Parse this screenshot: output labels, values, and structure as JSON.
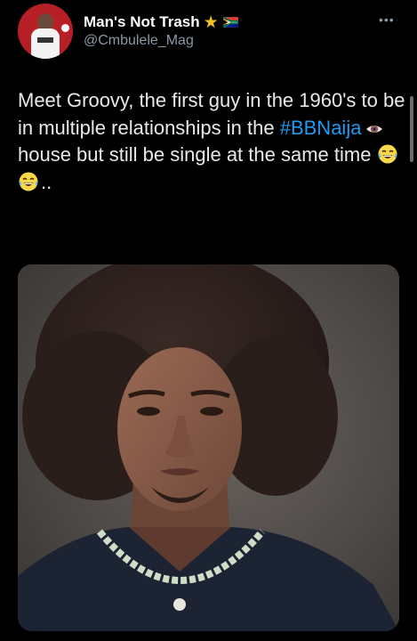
{
  "author": {
    "display_name": "Man's Not Trash",
    "handle": "@Cmbulele_Mag",
    "badge_icon": "star-icon",
    "flag_icon": "south-africa-flag-icon"
  },
  "more_icon": "ellipsis-icon",
  "tweet": {
    "text_before": "Meet Groovy, the first guy in the 1960's to be in multiple relationships in the ",
    "hashtag": "#BBNaija",
    "text_after": "house but still be single at the same time ",
    "text_tail": ".."
  },
  "media": {
    "kind": "photo"
  },
  "colors": {
    "background": "#000000",
    "hashtag": "#1d9bf0",
    "secondary_text": "#8b98a5",
    "star": "#f4c024"
  }
}
